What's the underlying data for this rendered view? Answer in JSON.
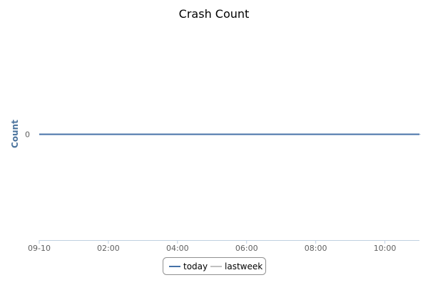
{
  "chart_data": {
    "type": "line",
    "title": "Crash Count",
    "ylabel": "Count",
    "xlabel": "",
    "x_ticks": [
      "09-10",
      "02:00",
      "04:00",
      "06:00",
      "08:00",
      "10:00"
    ],
    "x_range": [
      "09-10 00:00",
      "09-10 11:00"
    ],
    "y_ticks": [
      "0"
    ],
    "ylim": [
      -1,
      1
    ],
    "grid": false,
    "legend_position": "bottom-center",
    "series": [
      {
        "name": "today",
        "color": "#4572a7",
        "x": [
          "00:00",
          "11:00"
        ],
        "y": [
          0,
          0
        ]
      },
      {
        "name": "lastweek",
        "color": "#c0c0c0",
        "x": [
          "00:00",
          "11:00"
        ],
        "y": [
          0,
          0
        ]
      }
    ]
  }
}
